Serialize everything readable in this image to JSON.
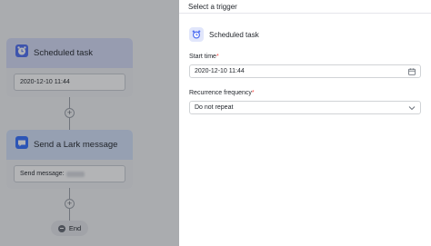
{
  "canvas": {
    "node1": {
      "title": "Scheduled task",
      "value": "2020-12-10 11:44"
    },
    "node2": {
      "title": "Send a Lark message",
      "field_label": "Send message:"
    },
    "add_symbol": "+",
    "end_label": "End"
  },
  "panel": {
    "title": "Select a trigger",
    "close_symbol": "✕",
    "trigger": {
      "label": "Scheduled task",
      "icon": "clock-icon"
    },
    "start_time": {
      "label": "Start time",
      "required_mark": "*",
      "value": "2020-12-10 11:44",
      "icon": "calendar-icon"
    },
    "recurrence": {
      "label": "Recurrence frequency",
      "required_mark": "*",
      "value": "Do not repeat",
      "icon": "chevron-down-icon"
    }
  },
  "colors": {
    "accent": "#3370ff",
    "required": "#f54a45",
    "node_header": "#d5dbf6"
  }
}
